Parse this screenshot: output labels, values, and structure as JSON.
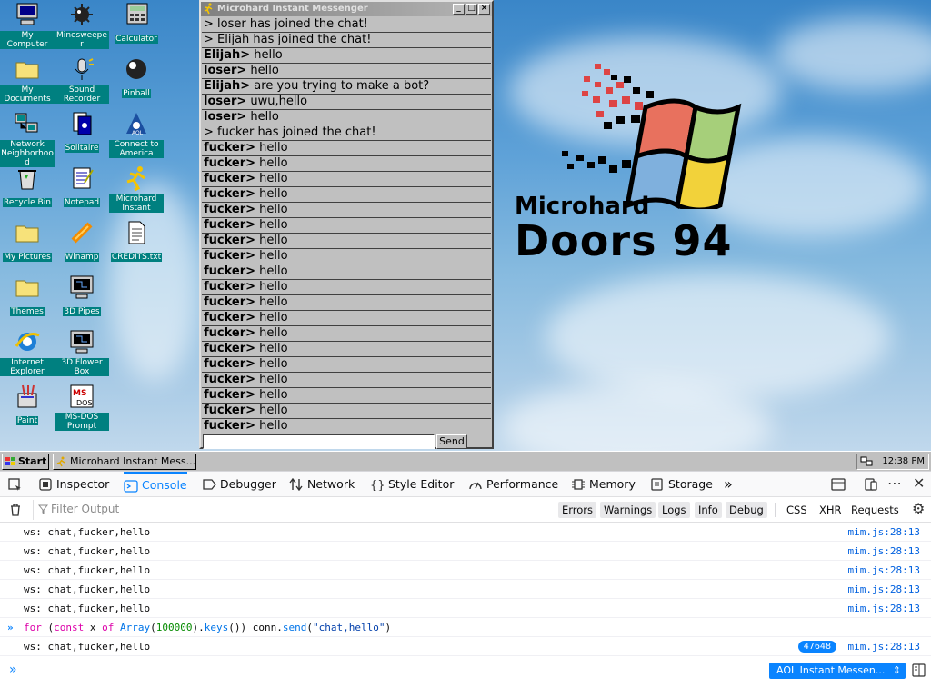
{
  "desktop": {
    "icons": [
      {
        "label": "My Computer",
        "icon": "computer-icon"
      },
      {
        "label": "Minesweeper",
        "icon": "mine-icon"
      },
      {
        "label": "Calculator",
        "icon": "calculator-icon"
      },
      {
        "label": "My Documents",
        "icon": "folder-icon"
      },
      {
        "label": "Sound Recorder",
        "icon": "microphone-icon"
      },
      {
        "label": "Pinball",
        "icon": "pinball-icon"
      },
      {
        "label": "Network Neighborhood",
        "icon": "network-icon"
      },
      {
        "label": "Solitaire",
        "icon": "cards-icon"
      },
      {
        "label": "Connect to America",
        "icon": "aol-icon"
      },
      {
        "label": "Recycle Bin",
        "icon": "recycle-bin-icon"
      },
      {
        "label": "Notepad",
        "icon": "notepad-icon"
      },
      {
        "label": "Microhard Instant",
        "icon": "running-man-icon"
      },
      {
        "label": "My Pictures",
        "icon": "folder-icon"
      },
      {
        "label": "Winamp",
        "icon": "winamp-icon"
      },
      {
        "label": "CREDITS.txt",
        "icon": "text-file-icon"
      },
      {
        "label": "Themes",
        "icon": "folder-icon"
      },
      {
        "label": "3D Pipes",
        "icon": "monitor-icon"
      },
      {
        "label": "Internet Explorer",
        "icon": "ie-icon"
      },
      {
        "label": "3D Flower Box",
        "icon": "monitor-icon"
      },
      {
        "label": "Paint",
        "icon": "paint-icon"
      },
      {
        "label": "MS-DOS Prompt",
        "icon": "msdos-icon"
      }
    ],
    "logo": {
      "line1": "Microhard",
      "line2": "Doors 94"
    }
  },
  "messenger": {
    "title": "Microhard Instant Messenger",
    "messages": [
      {
        "user": "",
        "text": "> loser has joined the chat!"
      },
      {
        "user": "",
        "text": "> Elijah has joined the chat!"
      },
      {
        "user": "Elijah>",
        "text": " hello"
      },
      {
        "user": "loser>",
        "text": " hello"
      },
      {
        "user": "Elijah>",
        "text": " are you trying to make a bot?"
      },
      {
        "user": "loser>",
        "text": " uwu,hello"
      },
      {
        "user": "loser>",
        "text": " hello"
      },
      {
        "user": "",
        "text": "> fucker has joined the chat!"
      },
      {
        "user": "fucker>",
        "text": " hello"
      },
      {
        "user": "fucker>",
        "text": " hello"
      },
      {
        "user": "fucker>",
        "text": " hello"
      },
      {
        "user": "fucker>",
        "text": " hello"
      },
      {
        "user": "fucker>",
        "text": " hello"
      },
      {
        "user": "fucker>",
        "text": " hello"
      },
      {
        "user": "fucker>",
        "text": " hello"
      },
      {
        "user": "fucker>",
        "text": " hello"
      },
      {
        "user": "fucker>",
        "text": " hello"
      },
      {
        "user": "fucker>",
        "text": " hello"
      },
      {
        "user": "fucker>",
        "text": " hello"
      },
      {
        "user": "fucker>",
        "text": " hello"
      },
      {
        "user": "fucker>",
        "text": " hello"
      },
      {
        "user": "fucker>",
        "text": " hello"
      },
      {
        "user": "fucker>",
        "text": " hello"
      },
      {
        "user": "fucker>",
        "text": " hello"
      },
      {
        "user": "fucker>",
        "text": " hello"
      },
      {
        "user": "fucker>",
        "text": " hello"
      },
      {
        "user": "fucker>",
        "text": " hello"
      },
      {
        "user": "fucker>",
        "text": " hello"
      },
      {
        "user": "fucker>",
        "text": " hello"
      }
    ],
    "input_value": "",
    "send_label": "Send"
  },
  "taskbar": {
    "start_label": "Start",
    "task_label": "Microhard Instant Mess...",
    "clock": "12:38 PM"
  },
  "devtools": {
    "tabs": [
      "Inspector",
      "Console",
      "Debugger",
      "Network",
      "Style Editor",
      "Performance",
      "Memory",
      "Storage"
    ],
    "active_tab": "Console",
    "filter_placeholder": "Filter Output",
    "filter_chips": [
      "Errors",
      "Warnings",
      "Logs",
      "Info",
      "Debug"
    ],
    "extra_chips": [
      "CSS",
      "XHR",
      "Requests"
    ],
    "logs": [
      {
        "text": "ws: chat,fucker,hello",
        "source": "mim.js:28:13"
      },
      {
        "text": "ws: chat,fucker,hello",
        "source": "mim.js:28:13"
      },
      {
        "text": "ws: chat,fucker,hello",
        "source": "mim.js:28:13"
      },
      {
        "text": "ws: chat,fucker,hello",
        "source": "mim.js:28:13"
      },
      {
        "text": "ws: chat,fucker,hello",
        "source": "mim.js:28:13"
      }
    ],
    "command": {
      "for": "for",
      "const": "const",
      "x": "x",
      "of": "of",
      "array": "Array",
      "num": "100000",
      "keys": "keys",
      "conn": "conn",
      "send": "send",
      "str": "\"chat,hello\""
    },
    "last_log": {
      "text": "ws: chat,fucker,hello",
      "source": "mim.js:28:13",
      "count": "47648"
    },
    "context_select": "AOL Instant Messen..."
  },
  "colors": {
    "desktop_label_bg": "#008080",
    "window_face": "#c0c0c0",
    "devtools_accent": "#0a84ff"
  }
}
